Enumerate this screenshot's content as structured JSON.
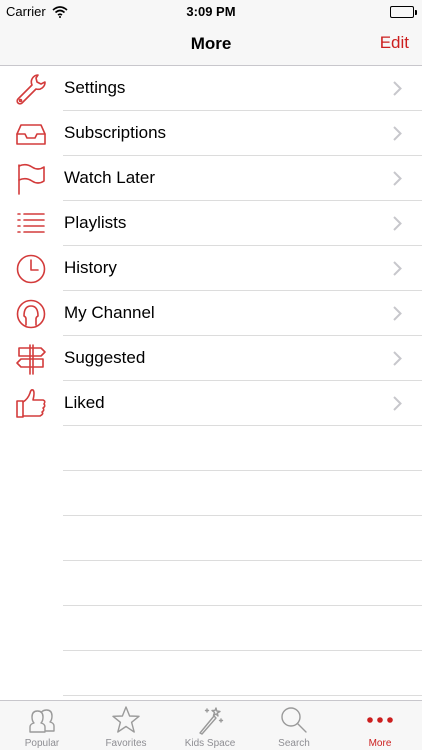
{
  "status_bar": {
    "carrier": "Carrier",
    "time": "3:09 PM"
  },
  "nav": {
    "title": "More",
    "edit_label": "Edit"
  },
  "menu": [
    {
      "label": "Settings",
      "icon": "wrench-icon"
    },
    {
      "label": "Subscriptions",
      "icon": "inbox-tray-icon"
    },
    {
      "label": "Watch Later",
      "icon": "flag-icon"
    },
    {
      "label": "Playlists",
      "icon": "list-icon"
    },
    {
      "label": "History",
      "icon": "clock-icon"
    },
    {
      "label": "My Channel",
      "icon": "user-circle-icon"
    },
    {
      "label": "Suggested",
      "icon": "signpost-icon"
    },
    {
      "label": "Liked",
      "icon": "thumbs-up-icon"
    }
  ],
  "tabs": [
    {
      "label": "Popular",
      "icon": "people-icon"
    },
    {
      "label": "Favorites",
      "icon": "star-icon"
    },
    {
      "label": "Kids Space",
      "icon": "magic-wand-icon"
    },
    {
      "label": "Search",
      "icon": "magnifier-icon"
    },
    {
      "label": "More",
      "icon": "more-dots-icon",
      "active": true
    }
  ],
  "colors": {
    "accent": "#cc1f1f",
    "icon": "#d33b3b",
    "inactive": "#8e8e93"
  }
}
